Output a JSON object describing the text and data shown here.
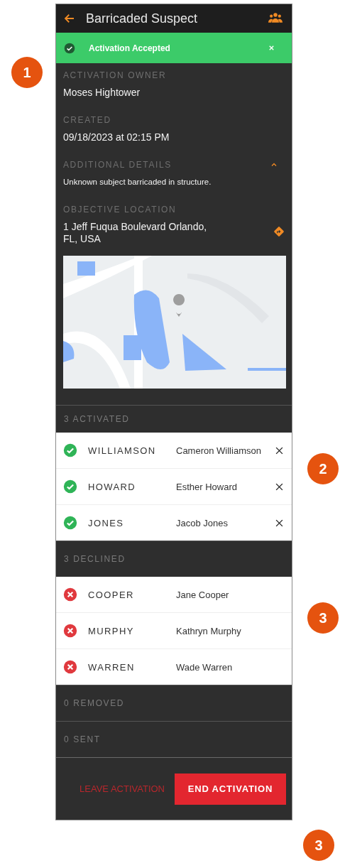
{
  "header": {
    "title": "Barricaded Suspect"
  },
  "banner": {
    "text": "Activation Accepted"
  },
  "details": [
    {
      "kind": "text",
      "label": "ACTIVATION OWNER",
      "value": "Moses Hightower"
    },
    {
      "kind": "text",
      "label": "CREATED",
      "value": "09/18/2023 at 02:15 PM"
    },
    {
      "kind": "collapsible",
      "label": "ADDITIONAL DETAILS",
      "value": "Unknown subject barricaded in structure.",
      "expanded": true
    },
    {
      "kind": "location",
      "label": "OBJECTIVE LOCATION",
      "value": "1 Jeff Fuqua Boulevard Orlando, FL, USA"
    }
  ],
  "groups": [
    {
      "title": "3 ACTIVATED",
      "kind": "accepted",
      "members": [
        {
          "surname": "WILLIAMSON",
          "name": "Cameron Williamson",
          "removable": true
        },
        {
          "surname": "HOWARD",
          "name": "Esther Howard",
          "removable": true
        },
        {
          "surname": "JONES",
          "name": "Jacob Jones",
          "removable": true
        }
      ]
    },
    {
      "title": "3 DECLINED",
      "kind": "declined",
      "members": [
        {
          "surname": "COOPER",
          "name": "Jane Cooper"
        },
        {
          "surname": "MURPHY",
          "name": "Kathryn Murphy"
        },
        {
          "surname": "WARREN",
          "name": "Wade Warren"
        }
      ]
    },
    {
      "title": "0 REMOVED"
    },
    {
      "title": "0 SENT"
    }
  ],
  "footer": {
    "buttons": [
      {
        "kind": "text",
        "label": "LEAVE ACTIVATION"
      },
      {
        "kind": "filled",
        "label": "END ACTIVATION"
      }
    ]
  },
  "callouts": [
    {
      "number": "1"
    },
    {
      "number": "2"
    },
    {
      "number": "3"
    },
    {
      "number": "3"
    }
  ]
}
